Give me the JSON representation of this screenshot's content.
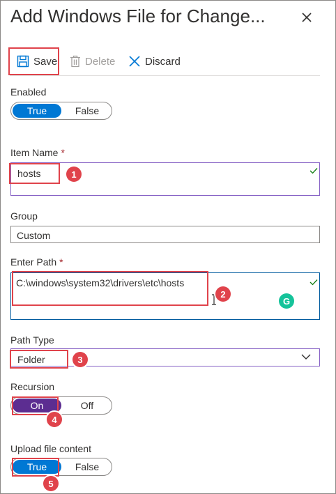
{
  "panel": {
    "title": "Add Windows File for Change..."
  },
  "toolbar": {
    "save_label": "Save",
    "delete_label": "Delete",
    "discard_label": "Discard"
  },
  "form": {
    "enabled": {
      "label": "Enabled",
      "on_label": "True",
      "off_label": "False",
      "selected": "True"
    },
    "item_name": {
      "label": "Item Name",
      "required_mark": "*",
      "value": "hosts"
    },
    "group": {
      "label": "Group",
      "value": "Custom"
    },
    "enter_path": {
      "label": "Enter Path",
      "required_mark": "*",
      "value": "C:\\windows\\system32\\drivers\\etc\\hosts"
    },
    "path_type": {
      "label": "Path Type",
      "value": "Folder"
    },
    "recursion": {
      "label": "Recursion",
      "on_label": "On",
      "off_label": "Off",
      "selected": "On"
    },
    "upload_file_content": {
      "label": "Upload file content",
      "on_label": "True",
      "off_label": "False",
      "selected": "True"
    }
  },
  "annotations": [
    "1",
    "2",
    "3",
    "4",
    "5"
  ],
  "grammarly": {
    "glyph": "G"
  },
  "colors": {
    "accent": "#0078d4",
    "purple": "#5c2d91",
    "annotation_red": "#e0434b",
    "valid_check": "#107c10"
  }
}
